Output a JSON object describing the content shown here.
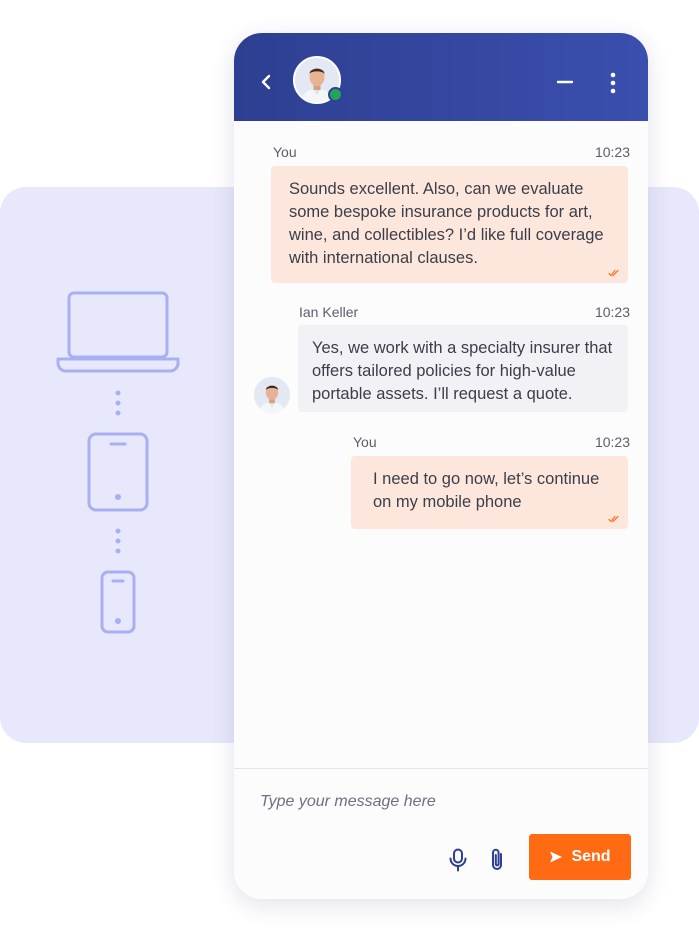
{
  "colors": {
    "header": "#2f4194",
    "outgoing_bubble": "#fde7dc",
    "incoming_bubble": "#f2f2f6",
    "send_button": "#ff6a13",
    "online": "#20a45a",
    "panel": "#e7e8fb",
    "device_outline": "#a9b0f2"
  },
  "icons": {
    "back": "chevron-left-icon",
    "minimize": "minus-icon",
    "more": "more-vertical-icon",
    "mic": "microphone-icon",
    "attach": "paperclip-icon",
    "send": "send-arrow-icon",
    "read": "double-check-icon"
  },
  "devices": [
    "laptop-icon",
    "tablet-icon",
    "phone-icon"
  ],
  "messages": [
    {
      "sender": "You",
      "time": "10:23",
      "direction": "outgoing",
      "lines": [
        "Sounds excellent. Also, can we evaluate",
        "some bespoke insurance products for art,",
        "wine, and collectibles? I’d like full coverage",
        "with international clauses."
      ]
    },
    {
      "sender": "Ian Keller",
      "time": "10:23",
      "direction": "incoming",
      "lines": [
        "Yes, we work with a specialty insurer that",
        "offers tailored policies for high-value",
        "portable assets. I’ll request a quote."
      ]
    },
    {
      "sender": "You",
      "time": "10:23",
      "direction": "outgoing",
      "lines": [
        "I need to go now, let’s continue",
        "on my mobile phone"
      ]
    }
  ],
  "composer": {
    "placeholder": "Type your message here",
    "value": "",
    "send_label": "Send"
  }
}
